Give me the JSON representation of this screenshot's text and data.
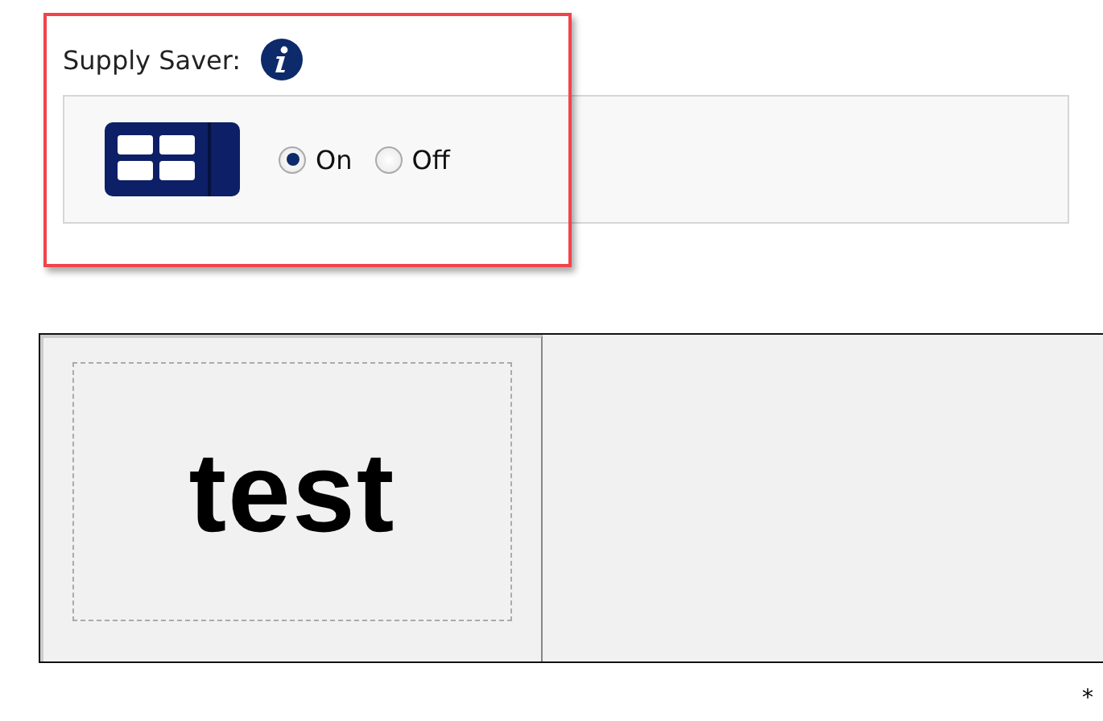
{
  "setting": {
    "label": "Supply Saver:",
    "options": [
      {
        "label": "On",
        "selected": true
      },
      {
        "label": "Off",
        "selected": false
      }
    ]
  },
  "preview": {
    "text": "test"
  },
  "footnote": "*"
}
